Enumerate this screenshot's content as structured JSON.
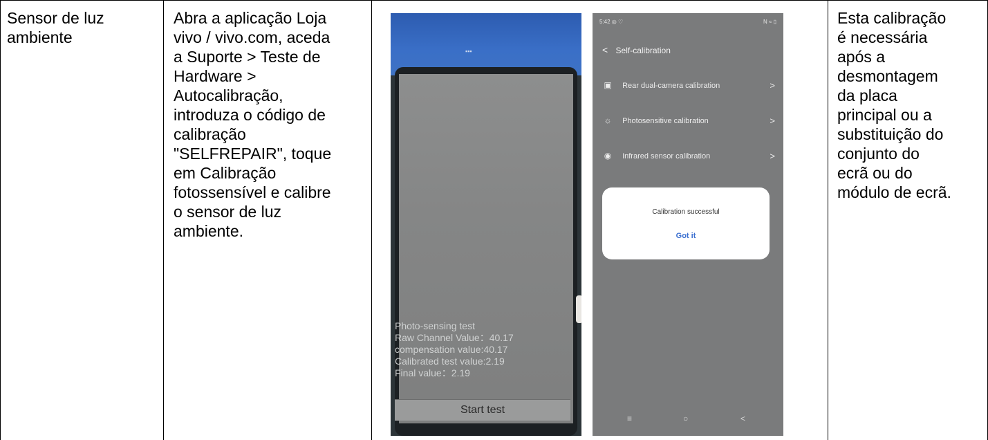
{
  "table": {
    "col1": "Sensor de luz\nambiente",
    "col2": "Abra a aplicação Loja\nvivo / vivo.com, aceda\na Suporte > Teste de\nHardware >\nAutocalibração,\nintroduza o código de\ncalibração\n\"SELFREPAIR\", toque\nem Calibração\nfotossensível e calibre\no sensor de luz\nambiente.",
    "col4": "Esta calibração\né necessária\napós a\ndesmontagem\nda placa\nprincipal ou a\nsubstituição do\nconjunto do\necrã ou do\nmódulo de ecrã."
  },
  "photo": {
    "test_title": "Photo-sensing test",
    "raw_channel": "Raw Channel Value：40.17",
    "compensation": "compensation value:40.17",
    "calibrated": "Calibrated test value:2.19",
    "final": "Final value：2.19",
    "start_button": "Start test"
  },
  "screenshot": {
    "status_time": "5:42 ◎ ♡",
    "status_right": "N ≈ ▯",
    "title": "Self-calibration",
    "items": [
      {
        "label": "Rear dual-camera calibration",
        "icon": "camera-square-icon"
      },
      {
        "label": "Photosensitive calibration",
        "icon": "sun-icon"
      },
      {
        "label": "Infrared sensor calibration",
        "icon": "infrared-icon"
      }
    ],
    "dialog_message": "Calibration successful",
    "dialog_button": "Got it"
  }
}
